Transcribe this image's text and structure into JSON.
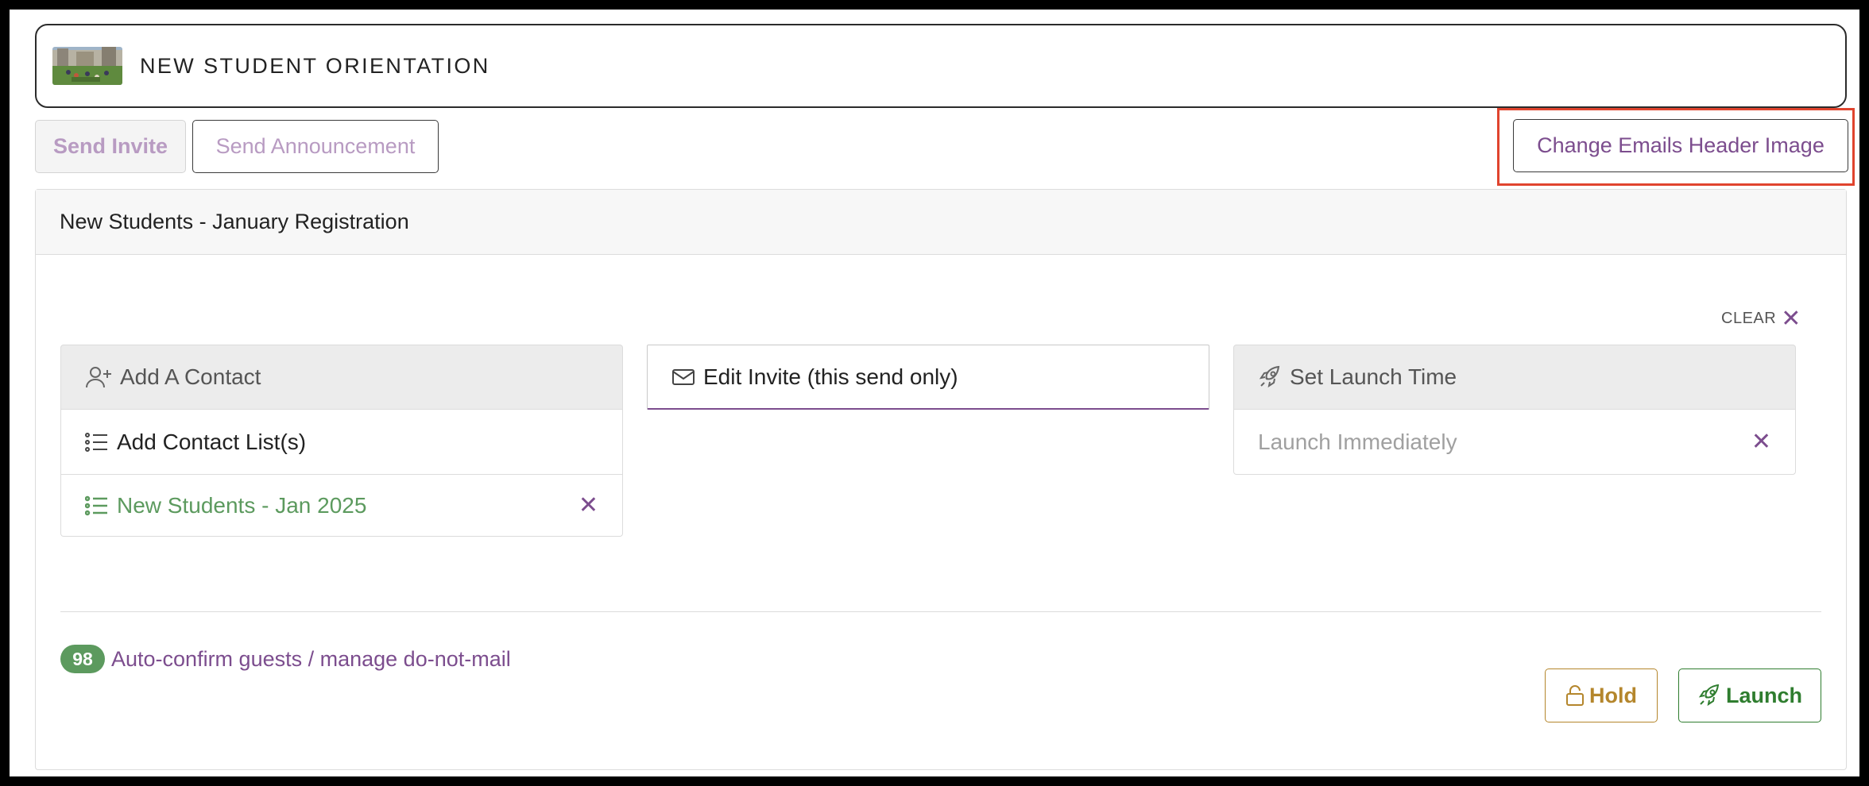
{
  "event": {
    "title": "NEW STUDENT ORIENTATION",
    "thumbnail_icon": "campus-photo"
  },
  "toolbar": {
    "send_invite": "Send Invite",
    "send_announcement": "Send Announcement",
    "change_header_image": "Change Emails Header Image"
  },
  "panel": {
    "heading": "New Students - January Registration",
    "clear_label": "CLEAR",
    "clear_icon": "close-icon",
    "contacts": {
      "add_contact": "Add A Contact",
      "add_contact_lists": "Add Contact List(s)",
      "selected_list": "New Students - Jan 2025"
    },
    "invite": {
      "edit_invite": "Edit Invite (this send only)"
    },
    "launch": {
      "set_launch_time": "Set Launch Time",
      "launch_mode": "Launch Immediately"
    },
    "auto_confirm": {
      "count": "98",
      "label": "Auto-confirm guests / manage do-not-mail"
    },
    "actions": {
      "hold": "Hold",
      "launch": "Launch"
    }
  },
  "colors": {
    "accent_purple": "#7c4d8e",
    "muted_purple": "#b89bc2",
    "success_green": "#5c9a5e",
    "launch_green": "#2f7d2f",
    "hold_amber": "#b4862c",
    "highlight_red": "#e0442e"
  }
}
